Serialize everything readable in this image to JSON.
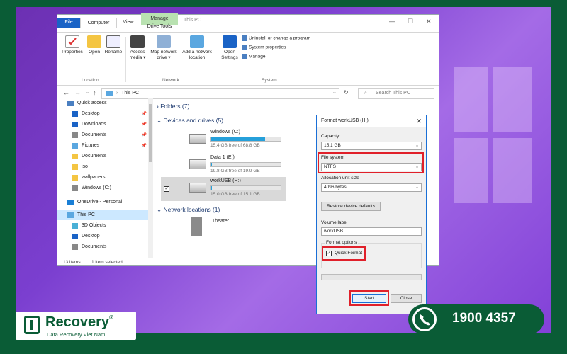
{
  "explorer": {
    "title": "This PC",
    "tabs": {
      "file": "File",
      "computer": "Computer",
      "view": "View",
      "context_header": "Manage",
      "drive_tools": "Drive Tools"
    },
    "ribbon": {
      "properties": "Properties",
      "open": "Open",
      "rename": "Rename",
      "access_media": "Access media ▾",
      "map_network_drive": "Map network drive ▾",
      "add_network_location": "Add a network location",
      "open_settings": "Open Settings",
      "uninstall": "Uninstall or change a program",
      "system_properties": "System properties",
      "manage": "Manage",
      "group_location": "Location",
      "group_network": "Network",
      "group_system": "System"
    },
    "address": {
      "path": "This PC",
      "search_placeholder": "Search This PC"
    },
    "nav": [
      {
        "label": "Quick access",
        "pinned": false
      },
      {
        "label": "Desktop",
        "pinned": true
      },
      {
        "label": "Downloads",
        "pinned": true
      },
      {
        "label": "Documents",
        "pinned": true
      },
      {
        "label": "Pictures",
        "pinned": true
      },
      {
        "label": "Documents",
        "pinned": false
      },
      {
        "label": "iso",
        "pinned": false
      },
      {
        "label": "wallpapers",
        "pinned": false
      },
      {
        "label": "Windows (C:)",
        "pinned": false
      },
      {
        "label": "OneDrive - Personal",
        "pinned": false
      },
      {
        "label": "This PC",
        "pinned": false
      },
      {
        "label": "3D Objects",
        "pinned": false
      },
      {
        "label": "Desktop",
        "pinned": false
      },
      {
        "label": "Documents",
        "pinned": false
      }
    ],
    "sections": {
      "folders": "Folders (7)",
      "devices": "Devices and drives (5)",
      "network": "Network locations (1)"
    },
    "drives": [
      {
        "name": "Windows (C:)",
        "size": "15.4 GB free of 68.8 GB",
        "used_fraction": 0.78
      },
      {
        "name": "Data 1 (E:)",
        "size": "19.8 GB free of 19.9 GB",
        "used_fraction": 0.01
      },
      {
        "name": "workUSB (H:)",
        "size": "15.0 GB free of 15.1 GB",
        "used_fraction": 0.01
      }
    ],
    "network_item": "Theater",
    "status": {
      "items": "13 items",
      "selected": "1 item selected"
    }
  },
  "format_dialog": {
    "title": "Format workUSB (H:)",
    "capacity_label": "Capacity:",
    "capacity_value": "15.1 GB",
    "fs_label": "File system",
    "fs_value": "NTFS",
    "alloc_label": "Allocation unit size",
    "alloc_value": "4096 bytes",
    "restore_button": "Restore device defaults",
    "volume_label": "Volume label",
    "volume_value": "workUSB",
    "format_options": "Format options",
    "quick_format": "Quick Format",
    "start_button": "Start",
    "close_button": "Close"
  },
  "branding": {
    "logo_name": "Recovery",
    "logo_reg": "®",
    "logo_sub": "Data Recovery Viet Nam",
    "hotline": "1900 4357"
  },
  "colors": {
    "accent": "#1a63c6",
    "highlight": "#e0202a",
    "brand_green": "#0a5c36",
    "drive_bar": "#26a0da"
  }
}
